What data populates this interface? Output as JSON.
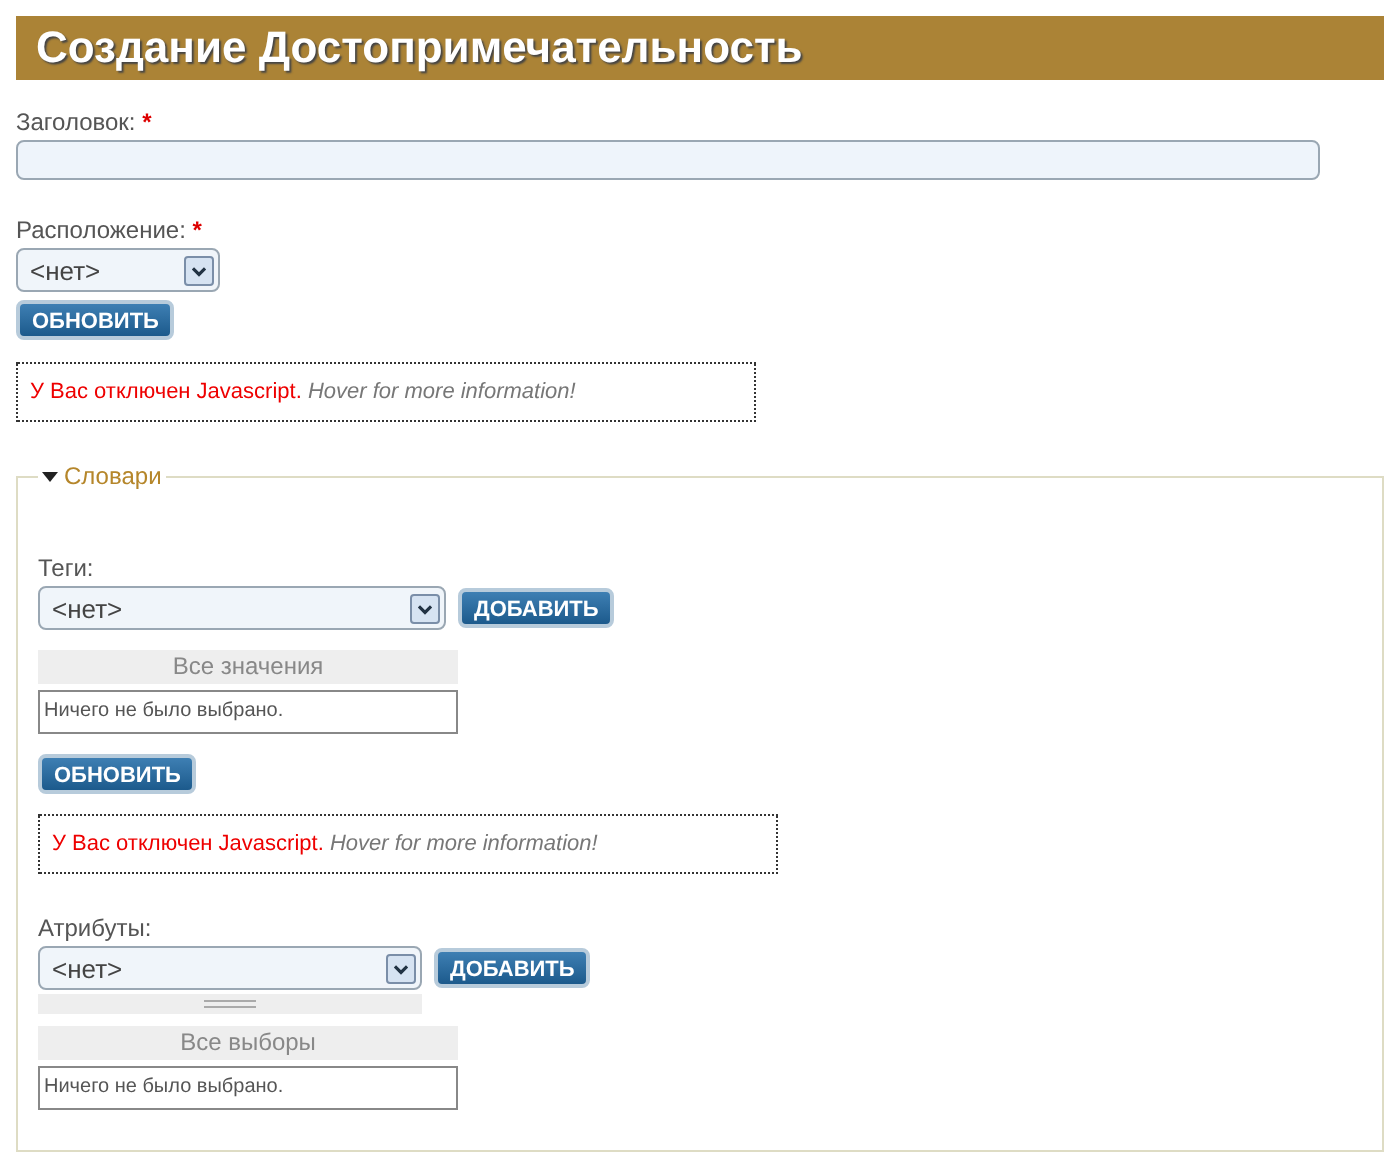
{
  "page_title": "Создание Достопримечательность",
  "fields": [
    {
      "kind": "text",
      "label": "Заголовок:",
      "required_mark": "*"
    },
    {
      "kind": "select",
      "label": "Расположение:",
      "required_mark": "*",
      "value": "<нет>"
    }
  ],
  "update_button": "ОБНОВИТЬ",
  "notice": {
    "message": "У Вас отключен Javascript.",
    "hint": "Hover for more information!"
  },
  "fieldset": {
    "legend": "Словари",
    "expanded": true,
    "groups": [
      {
        "kind": "tags",
        "label": "Теги:",
        "value": "<нет>",
        "add_button": "ДОБАВИТЬ",
        "list_header": "Все значения",
        "empty_text": "Ничего не было выбрано.",
        "update_button": "ОБНОВИТЬ",
        "notice": {
          "message": "У Вас отключен Javascript.",
          "hint": "Hover for more information!"
        }
      },
      {
        "kind": "attributes",
        "label": "Атрибуты:",
        "value": "<нет>",
        "add_button": "ДОБАВИТЬ",
        "list_header": "Все выборы",
        "empty_text": "Ничего не было выбрано."
      }
    ]
  }
}
